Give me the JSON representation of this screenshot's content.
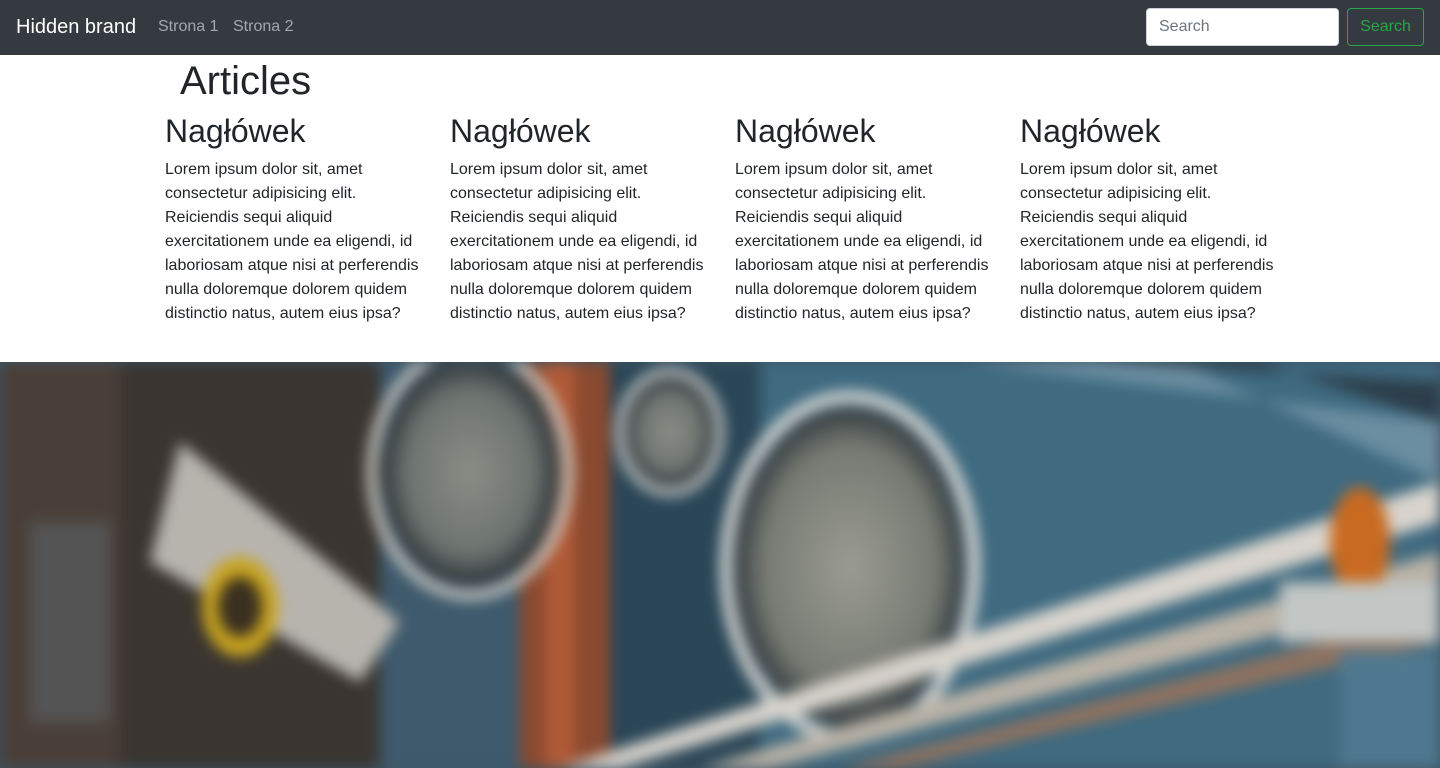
{
  "navbar": {
    "brand": "Hidden brand",
    "links": [
      "Strona 1",
      "Strona 2"
    ],
    "search_placeholder": "Search",
    "search_button": "Search"
  },
  "main": {
    "title": "Articles",
    "articles": [
      {
        "heading": "Nagłówek",
        "body": "Lorem ipsum dolor sit, amet consectetur adipisicing elit. Reiciendis sequi aliquid exercitationem unde ea eligendi, id laboriosam atque nisi at perferendis nulla doloremque dolorem quidem distinctio natus, autem eius ipsa?"
      },
      {
        "heading": "Nagłówek",
        "body": "Lorem ipsum dolor sit, amet consectetur adipisicing elit. Reiciendis sequi aliquid exercitationem unde ea eligendi, id laboriosam atque nisi at perferendis nulla doloremque dolorem quidem distinctio natus, autem eius ipsa?"
      },
      {
        "heading": "Nagłówek",
        "body": "Lorem ipsum dolor sit, amet consectetur adipisicing elit. Reiciendis sequi aliquid exercitationem unde ea eligendi, id laboriosam atque nisi at perferendis nulla doloremque dolorem quidem distinctio natus, autem eius ipsa?"
      },
      {
        "heading": "Nagłówek",
        "body": "Lorem ipsum dolor sit, amet consectetur adipisicing elit. Reiciendis sequi aliquid exercitationem unde ea eligendi, id laboriosam atque nisi at perferendis nulla doloremque dolorem quidem distinctio natus, autem eius ipsa?"
      }
    ]
  },
  "colors": {
    "navbar_bg": "#343a40",
    "brand_text": "#ffffff",
    "nav_link": "#9a9da0",
    "success": "#28a745",
    "text": "#212529"
  },
  "hero_icon": "blurred-dashboard-photo"
}
